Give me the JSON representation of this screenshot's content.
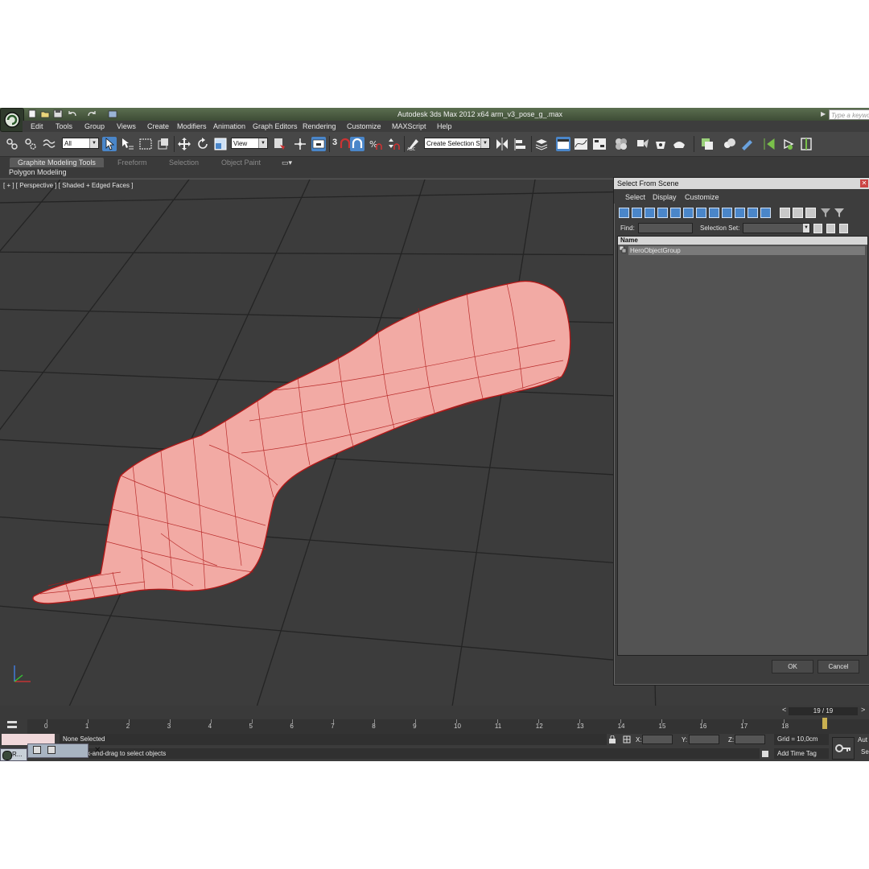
{
  "window": {
    "title": "Autodesk 3ds Max  2012 x64",
    "file": "arm_v3_pose_g_.max",
    "search_placeholder": "Type a keyword"
  },
  "menubar": [
    "Edit",
    "Tools",
    "Group",
    "Views",
    "Create",
    "Modifiers",
    "Animation",
    "Graph Editors",
    "Rendering",
    "Customize",
    "MAXScript",
    "Help"
  ],
  "toolbar": {
    "filter_value": "All",
    "ref_coord_value": "View",
    "selection_set_value": "Create Selection Se",
    "snap_label": "3"
  },
  "ribbon": {
    "tabs": [
      "Graphite Modeling Tools",
      "Freeform",
      "Selection",
      "Object Paint"
    ],
    "panel_label": "Polygon Modeling"
  },
  "viewport": {
    "label": "[ + ] [ Perspective ] [ Shaded + Edged Faces ]"
  },
  "dialog": {
    "title": "Select From Scene",
    "menus": [
      "Select",
      "Display",
      "Customize"
    ],
    "find_label": "Find:",
    "selection_set_label": "Selection Set:",
    "column_header": "Name",
    "items": [
      "HeroObjectGroup"
    ],
    "ok_label": "OK",
    "cancel_label": "Cancel"
  },
  "timeline": {
    "counter": "19 / 19",
    "ticks": [
      "0",
      "1",
      "2",
      "3",
      "4",
      "5",
      "6",
      "7",
      "8",
      "9",
      "10",
      "11",
      "12",
      "13",
      "14",
      "15",
      "16",
      "17",
      "18"
    ],
    "current_frame": 19,
    "total_frames": 19
  },
  "status": {
    "selection": "None Selected",
    "prompt": "ck-and-drag to select objects",
    "x_label": "X:",
    "y_label": "Y:",
    "z_label": "Z:",
    "grid": "Grid = 10,0cm",
    "add_time_tag": "Add Time Tag",
    "auto_label": "Aut",
    "set_label": "Se"
  },
  "taskbar": {
    "button_label": "R..."
  },
  "colors": {
    "selection_highlight": "#4a86c9",
    "mesh_fill": "#f2aaa4",
    "mesh_wire": "#b01818",
    "viewport_bg": "#3c3c3c"
  }
}
